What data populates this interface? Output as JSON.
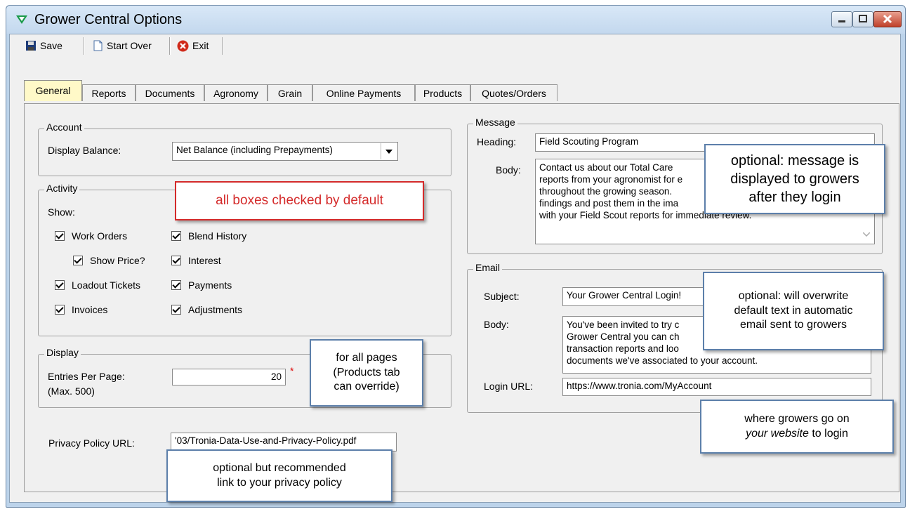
{
  "window": {
    "title": "Grower Central Options"
  },
  "toolbar": {
    "save_label": "Save",
    "start_over_label": "Start Over",
    "exit_label": "Exit"
  },
  "tabs": [
    {
      "label": "General"
    },
    {
      "label": "Reports"
    },
    {
      "label": "Documents"
    },
    {
      "label": "Agronomy"
    },
    {
      "label": "Grain"
    },
    {
      "label": "Online Payments"
    },
    {
      "label": "Products"
    },
    {
      "label": "Quotes/Orders"
    }
  ],
  "account": {
    "legend": "Account",
    "display_balance_label": "Display Balance:",
    "display_balance_value": "Net Balance (including Prepayments)"
  },
  "activity": {
    "legend": "Activity",
    "show_label": "Show:",
    "items": [
      {
        "label": "Work Orders",
        "checked": true
      },
      {
        "label": "Show Price?",
        "checked": true
      },
      {
        "label": "Loadout Tickets",
        "checked": true
      },
      {
        "label": "Invoices",
        "checked": true
      },
      {
        "label": "Blend History",
        "checked": true
      },
      {
        "label": "Interest",
        "checked": true
      },
      {
        "label": "Payments",
        "checked": true
      },
      {
        "label": "Adjustments",
        "checked": true
      }
    ]
  },
  "display": {
    "legend": "Display",
    "entries_label": "Entries Per Page:",
    "max_label": "(Max. 500)",
    "entries_value": "20",
    "required_marker": "*"
  },
  "privacy": {
    "label": "Privacy Policy URL:",
    "value": "'03/Tronia-Data-Use-and-Privacy-Policy.pdf"
  },
  "message": {
    "legend": "Message",
    "heading_label": "Heading:",
    "heading_value": "Field Scouting Program",
    "body_label": "Body:",
    "body_lines": [
      "Contact us about our Total Care",
      "reports from your agronomist for e",
      "throughout the growing season.",
      "findings and post them in the ima",
      "with your Field Scout reports for immediate review."
    ]
  },
  "email": {
    "legend": "Email",
    "subject_label": "Subject:",
    "subject_value": "Your Grower Central Login!",
    "body_label": "Body:",
    "body_lines": [
      "You've been invited to try c",
      "Grower Central you can ch",
      "transaction reports and loo",
      "documents we've associated to your account."
    ],
    "login_label": "Login URL:",
    "login_value": "https://www.tronia.com/MyAccount"
  },
  "callouts": {
    "defaults": "all boxes checked by default",
    "all_pages": [
      "for all pages",
      "(Products tab",
      "can override)"
    ],
    "privacy": [
      "optional but recommended",
      "link to your privacy policy"
    ],
    "message": [
      "optional: message is",
      "displayed to growers",
      "after they login"
    ],
    "email": [
      "optional: will overwrite",
      "default text in automatic",
      "email sent to growers"
    ],
    "login": [
      "where growers go on",
      "your website",
      "to login"
    ]
  },
  "colors": {
    "callout_red": "#d42a2a",
    "callout_border_blue": "#5c7faa",
    "active_tab": "#fff9c8"
  }
}
